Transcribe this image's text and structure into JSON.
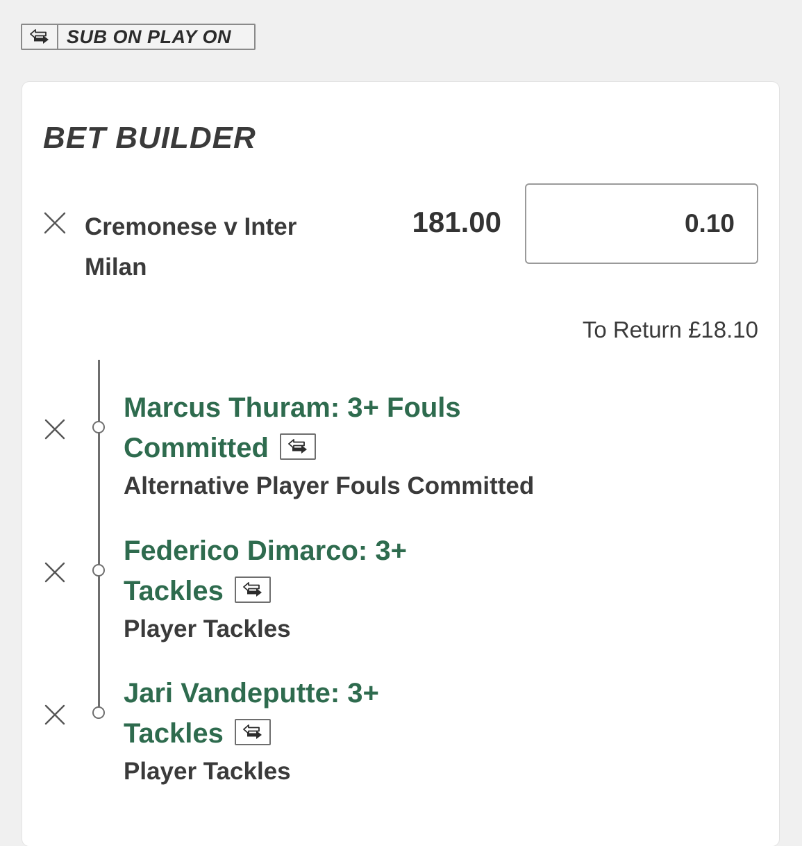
{
  "promo_badge": {
    "label": "SUB ON PLAY ON",
    "icon": "substitution-arrows-icon"
  },
  "bet_builder": {
    "title": "BET BUILDER",
    "event": {
      "name": "Cremonese v Inter Milan",
      "odds": "181.00",
      "stake": "0.10",
      "to_return": "To Return £18.10"
    },
    "legs": [
      {
        "selection_line1": "Marcus Thuram: 3+ Fouls",
        "selection_line2": "Committed",
        "market": "Alternative Player Fouls Committed",
        "icon": "substitution-arrows-icon"
      },
      {
        "selection_line1": "Federico Dimarco: 3+",
        "selection_line2": "Tackles",
        "market": "Player Tackles",
        "icon": "substitution-arrows-icon"
      },
      {
        "selection_line1": "Jari Vandeputte: 3+",
        "selection_line2": "Tackles",
        "market": "Player Tackles",
        "icon": "substitution-arrows-icon"
      }
    ]
  },
  "colors": {
    "selection_green": "#2e6b4e",
    "background": "#f0f0f0",
    "card": "#ffffff"
  }
}
